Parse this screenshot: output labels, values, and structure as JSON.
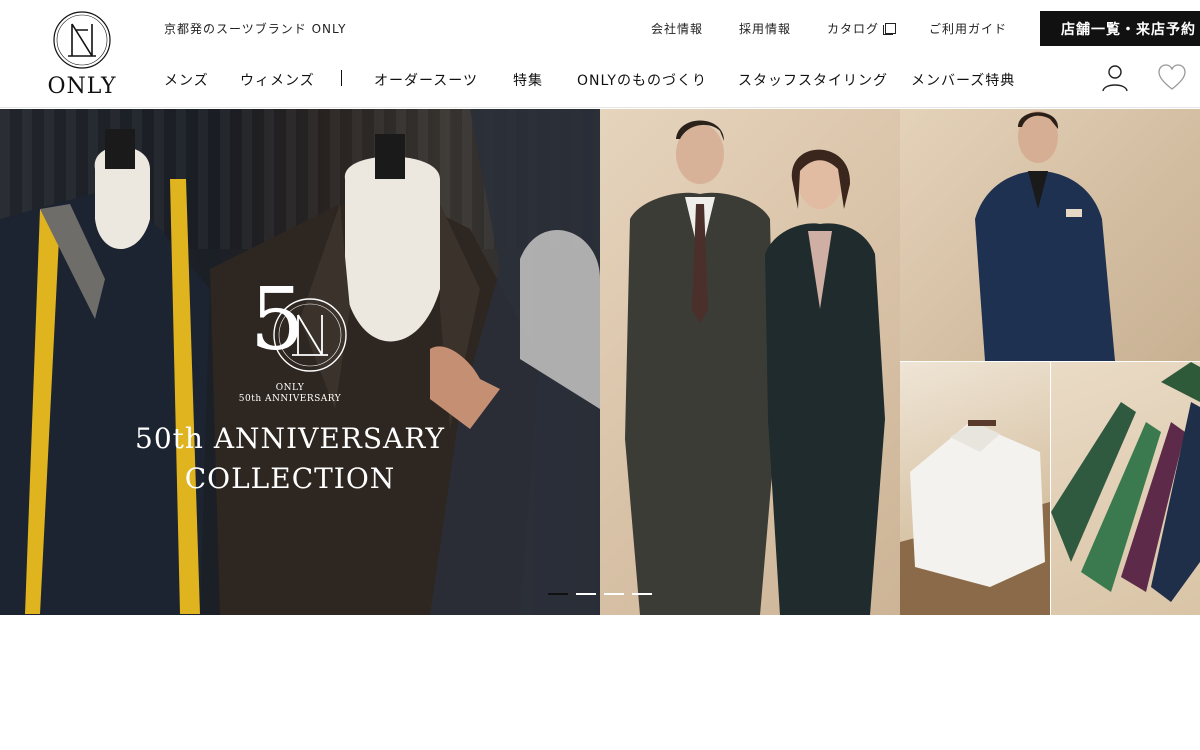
{
  "header": {
    "logo_text": "ONLY",
    "tagline": "京都発のスーツブランド ONLY",
    "util": {
      "company": "会社情報",
      "recruit": "採用情報",
      "catalog": "カタログ",
      "guide": "ご利用ガイド"
    },
    "store_button": "店舗一覧・来店予約",
    "nav": {
      "mens": "メンズ",
      "womens": "ウィメンズ",
      "order": "オーダースーツ",
      "feature": "特集",
      "craft": "ONLYのものづくり",
      "staff": "スタッフスタイリング",
      "members": "メンバーズ特典"
    },
    "icons": {
      "user": "user-icon",
      "favorite": "heart-icon",
      "external": "external-link-icon"
    }
  },
  "hero": {
    "emblem_digit": "5",
    "anniv_brand": "ONLY",
    "anniv_line": "50th ANNIVERSARY",
    "title_line1": "50th ANNIVERSARY",
    "title_line2": "COLLECTION",
    "carousel": {
      "count": 4,
      "active": 1
    }
  },
  "colors": {
    "primary": "#111111",
    "background": "#ffffff",
    "hero_warm": "#d9c3a8",
    "hero_dark": "#1f232a"
  }
}
